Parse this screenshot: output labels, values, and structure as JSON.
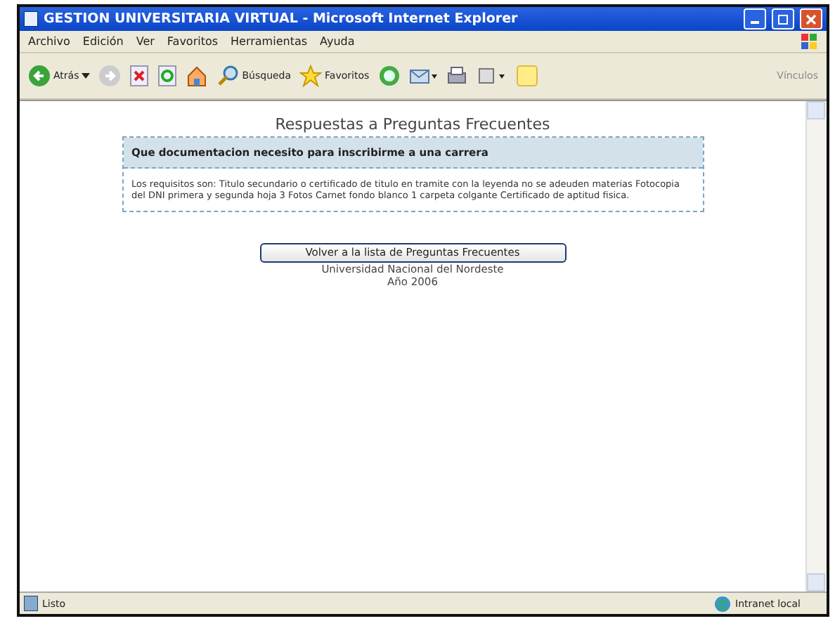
{
  "window": {
    "title": "GESTION UNIVERSITARIA VIRTUAL - Microsoft Internet Explorer"
  },
  "menu": [
    "Archivo",
    "Edición",
    "Ver",
    "Favoritos",
    "Herramientas",
    "Ayuda"
  ],
  "toolbar": {
    "back": "Atrás",
    "search": "Búsqueda",
    "favorites": "Favoritos",
    "links": "Vínculos"
  },
  "page": {
    "title": "Respuestas a Preguntas Frecuentes",
    "question": "Que documentacion necesito para inscribirme a una carrera",
    "answer": "Los requisitos son: Titulo secundario o certificado de titulo en tramite con la leyenda no se adeuden materias Fotocopia del DNI primera y segunda hoja 3 Fotos Carnet fondo blanco 1 carpeta colgante Certificado de aptitud fisica.",
    "button": "Volver a la lista de Preguntas Frecuentes",
    "footer": [
      "Universidad Nacional del Nordeste",
      "Año 2006"
    ]
  },
  "status_bar": {
    "text": "Listo",
    "zone": "Intranet local"
  }
}
